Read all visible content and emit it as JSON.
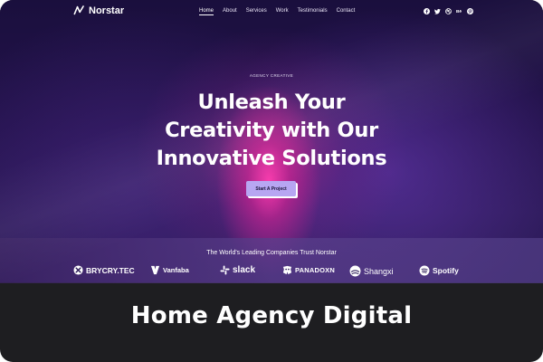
{
  "brand": {
    "name": "Norstar",
    "accent": "#b7a6f2"
  },
  "nav": {
    "items": [
      {
        "label": "Home",
        "active": true
      },
      {
        "label": "About"
      },
      {
        "label": "Services"
      },
      {
        "label": "Work"
      },
      {
        "label": "Testimonials"
      },
      {
        "label": "Contact"
      }
    ],
    "socials": [
      "facebook-icon",
      "twitter-icon",
      "dribbble-icon",
      "behance-icon",
      "pinterest-icon"
    ]
  },
  "hero": {
    "eyebrow": "AGENCY CREATIVE",
    "headline_lines": [
      "Unleash Your",
      "Creativity with Our",
      "Innovative Solutions"
    ],
    "cta_label": "Start A Project"
  },
  "trust": {
    "title": "The World's Leading Companies Trust Norstar",
    "logos": [
      {
        "label": "BRYCRY.TEC",
        "icon": "brycry-logo-icon"
      },
      {
        "label": "Vanfaba",
        "icon": "vanfaba-logo-icon"
      },
      {
        "label": "slack",
        "icon": "slack-logo-icon"
      },
      {
        "label": "PANADOXN",
        "icon": "panadoxn-logo-icon"
      },
      {
        "label": "Shangxi",
        "icon": "shangxi-logo-icon"
      },
      {
        "label": "Spotify",
        "icon": "spotify-logo-icon"
      }
    ]
  },
  "caption": "Home Agency Digital"
}
